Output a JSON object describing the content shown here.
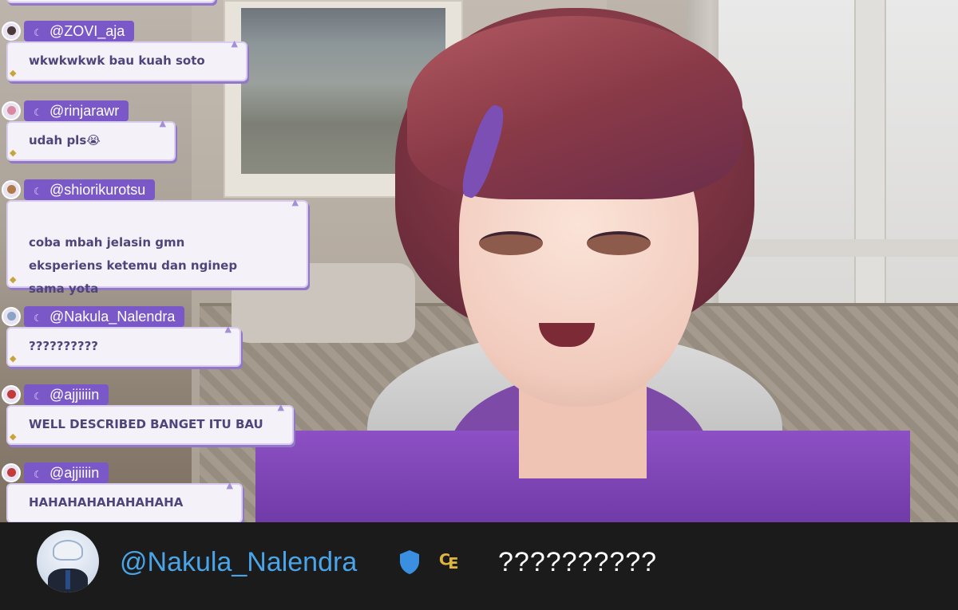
{
  "chat": {
    "messages": [
      {
        "username": "@ZOVI_aja",
        "text": "wkwkwkwk bau kuah soto",
        "avatar_color": "#4a3b3b"
      },
      {
        "username": "@rinjarawr",
        "text": "udah pls😭",
        "avatar_color": "#d98aa0"
      },
      {
        "username": "@shiorikurotsu",
        "text": "coba mbah jelasin gmn\neksperiens ketemu dan nginep\nsama yota",
        "avatar_color": "#b07a4a"
      },
      {
        "username": "@Nakula_Nalendra",
        "text": "??????????",
        "avatar_color": "#8aa4c6"
      },
      {
        "username": "@ajjiiiin",
        "text": "WELL DESCRIBED BANGET ITU BAU",
        "avatar_color": "#c23a3a"
      },
      {
        "username": "@ajjiiiin",
        "text": "HAHAHAHAHAHAHAHA",
        "avatar_color": "#c23a3a"
      }
    ],
    "name_badge_icon": "mic-badge-icon",
    "accent_color": "#7a58c8"
  },
  "highlight": {
    "username": "@Nakula_Nalendra",
    "message": "??????????",
    "verified_icon": "shield-icon",
    "currency_icon": "coin-icon",
    "username_color": "#4aa4e8",
    "shield_color": "#3a8fe0",
    "coin_color": "#e0b53d"
  }
}
